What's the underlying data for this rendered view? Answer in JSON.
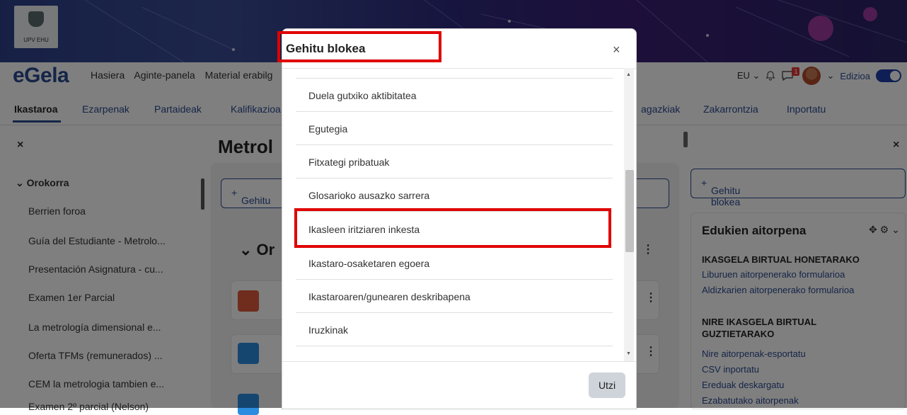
{
  "banner": {
    "logo_text": "UPV  EHU"
  },
  "navbar": {
    "brand": "eGela",
    "links": [
      "Hasiera",
      "Aginte-panela",
      "Material erabilg"
    ],
    "language": "EU",
    "notification_count": "1",
    "edit_label": "Edizioa"
  },
  "tabs": [
    {
      "label": "Ikastaroa"
    },
    {
      "label": "Ezarpenak"
    },
    {
      "label": "Partaideak"
    },
    {
      "label": "Kalifikazioa"
    },
    {
      "label": "agazkiak"
    },
    {
      "label": "Zakarrontzia"
    },
    {
      "label": "Inportatu"
    }
  ],
  "left_sidebar": {
    "close_glyph": "×",
    "section": "Orokorra",
    "items": [
      "Berrien foroa",
      "Guía del Estudiante - Metrolo...",
      "Presentación Asignatura - cu...",
      "Examen 1er Parcial",
      "La metrología dimensional e...",
      "Oferta TFMs (remunerados) ...",
      "CEM la metrologia tambien e...",
      "Examen 2º parcial (Nelson)"
    ]
  },
  "main": {
    "title": "Metrol",
    "add_block": "Gehitu",
    "section": "Or"
  },
  "right_sidebar": {
    "close_glyph": "×",
    "add_block": "Gehitu blokea",
    "block_title": "Edukien aitorpena",
    "head1": "IKASGELA BIRTUAL HONETARAKO",
    "links1": [
      "Liburuen aitorpenerako formularioa",
      "Aldizkarien aitorpenerako formularioa"
    ],
    "head2": "NIRE IKASGELA BIRTUAL GUZTIETARAKO",
    "links2": [
      "Nire aitorpenak-esportatu",
      "CSV inportatu",
      "Ereduak deskargatu",
      "Ezabatutako aitorpenak"
    ]
  },
  "modal": {
    "title": "Gehitu blokea",
    "close_glyph": "×",
    "items": [
      "Duela gutxiko aktibitatea",
      "Egutegia",
      "Fitxategi pribatuak",
      "Glosarioko ausazko sarrera",
      "Ikasleen iritziaren inkesta",
      "Ikastaro-osaketaren egoera",
      "Ikastaroaren/gunearen deskribapena",
      "Iruzkinak"
    ],
    "cancel": "Utzi",
    "highlighted_item": "Ikasleen iritziaren inkesta",
    "scroll_position": 0.35
  },
  "colors": {
    "brand": "#2a4a90",
    "highlight": "#e00000",
    "toggle": "#1e3da8",
    "badge": "#e43535"
  }
}
